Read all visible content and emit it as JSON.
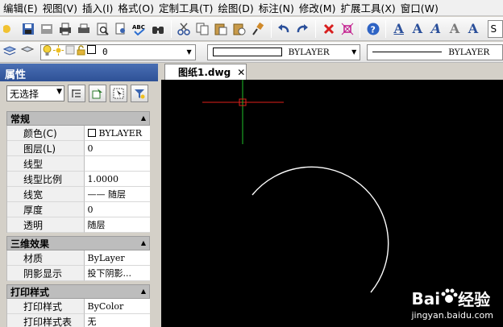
{
  "menubar": {
    "items": [
      "编辑(E)",
      "视图(V)",
      "插入(I)",
      "格式(O)",
      "定制工具(T)",
      "绘图(D)",
      "标注(N)",
      "修改(M)",
      "扩展工具(X)",
      "窗口(W)"
    ]
  },
  "toolbar": {
    "text_style_field": "S"
  },
  "layer_toolbar": {
    "layer_value": "0",
    "color_value": "BYLAYER",
    "linetype_value": "BYLAYER"
  },
  "properties_panel": {
    "title": "属性",
    "selection": "无选择",
    "groups": [
      {
        "title": "常规",
        "rows": [
          {
            "name": "颜色(C)",
            "value": "BYLAYER"
          },
          {
            "name": "图层(L)",
            "value": "0"
          },
          {
            "name": "线型",
            "value": ""
          },
          {
            "name": "线型比例",
            "value": "1.0000"
          },
          {
            "name": "线宽",
            "value": "—— 随层"
          },
          {
            "name": "厚度",
            "value": "0"
          },
          {
            "name": "透明",
            "value": "随层"
          }
        ]
      },
      {
        "title": "三维效果",
        "rows": [
          {
            "name": "材质",
            "value": "ByLayer"
          },
          {
            "name": "阴影显示",
            "value": "投下阴影..."
          }
        ]
      },
      {
        "title": "打印样式",
        "rows": [
          {
            "name": "打印样式",
            "value": "ByColor"
          },
          {
            "name": "打印样式表",
            "value": "无"
          }
        ]
      }
    ]
  },
  "document": {
    "tab_label": "图纸1.dwg",
    "close_glyph": "✕"
  },
  "watermark": {
    "brand_left": "Bai",
    "brand_right": "经验",
    "url": "jingyan.baidu.com"
  },
  "colors": {
    "canvas_bg": "#000000",
    "crosshair_x": "#e0201a",
    "crosshair_y": "#1fbf2a",
    "arc": "#ffffff",
    "panel_title_bg": "#2e5196"
  }
}
